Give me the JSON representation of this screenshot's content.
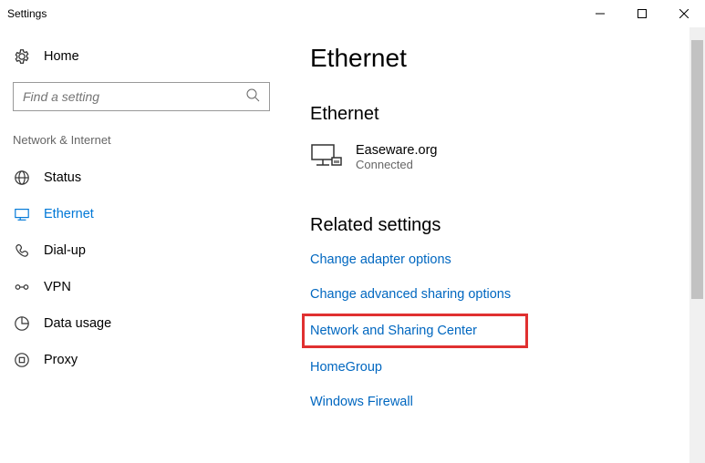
{
  "window": {
    "title": "Settings"
  },
  "sidebar": {
    "home_label": "Home",
    "search_placeholder": "Find a setting",
    "category": "Network & Internet",
    "items": [
      {
        "label": "Status"
      },
      {
        "label": "Ethernet"
      },
      {
        "label": "Dial-up"
      },
      {
        "label": "VPN"
      },
      {
        "label": "Data usage"
      },
      {
        "label": "Proxy"
      }
    ]
  },
  "main": {
    "title": "Ethernet",
    "section_heading": "Ethernet",
    "network": {
      "name": "Easeware.org",
      "status": "Connected"
    },
    "related_heading": "Related settings",
    "links": [
      "Change adapter options",
      "Change advanced sharing options",
      "Network and Sharing Center",
      "HomeGroup",
      "Windows Firewall"
    ]
  }
}
